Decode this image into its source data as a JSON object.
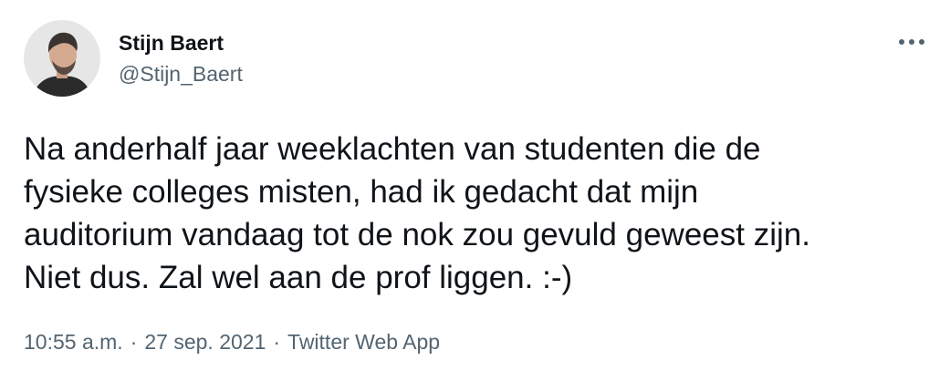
{
  "author": {
    "display_name": "Stijn Baert",
    "handle": "@Stijn_Baert"
  },
  "tweet": {
    "text": "Na anderhalf jaar weeklachten van studenten die de\nfysieke colleges misten, had ik gedacht dat mijn\nauditorium vandaag tot de nok zou gevuld geweest zijn.\nNiet dus. Zal wel aan de prof liggen. :-)",
    "time": "10:55 a.m.",
    "date": "27 sep. 2021",
    "source": "Twitter Web App",
    "separator": "·"
  },
  "icons": {
    "more": "more-horizontal-icon",
    "avatar": "profile-photo"
  },
  "colors": {
    "text_primary": "#0f1419",
    "text_secondary": "#536471",
    "background": "#ffffff"
  }
}
